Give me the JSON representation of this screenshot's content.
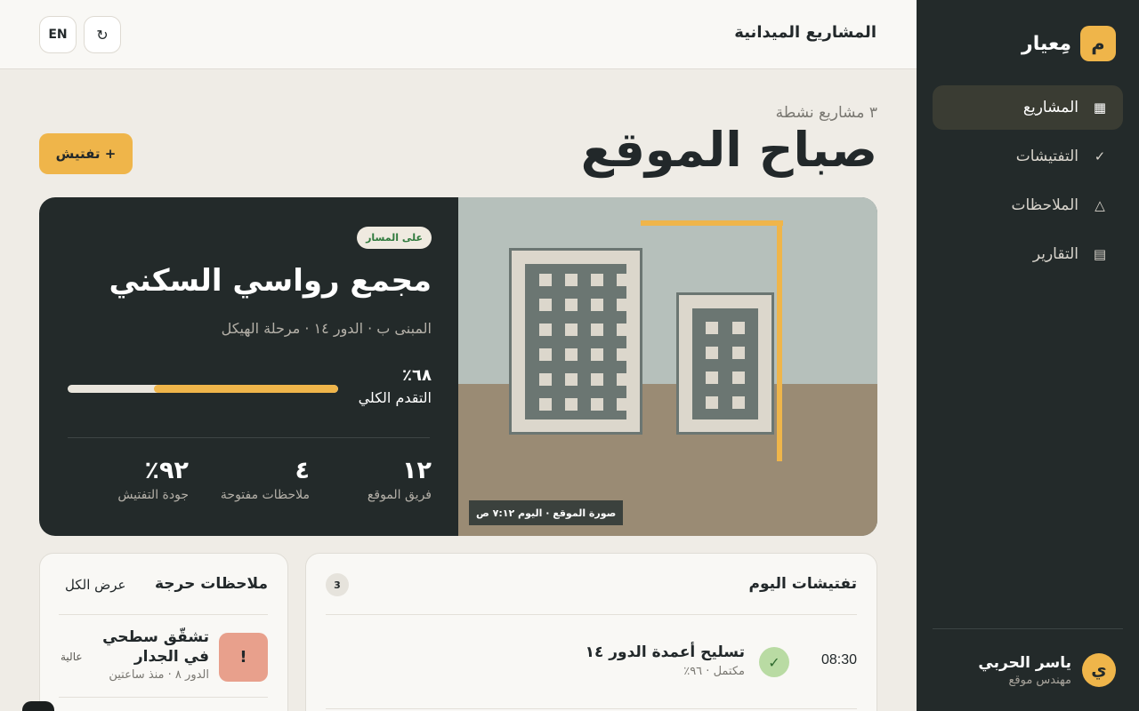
{
  "app": {
    "logo_letter": "م",
    "name": "مِعيار"
  },
  "sidebar": {
    "items": [
      {
        "label": "المشاريع",
        "icon": "grid-icon",
        "active": true
      },
      {
        "label": "التفتيشات",
        "icon": "check-icon",
        "active": false
      },
      {
        "label": "الملاحظات",
        "icon": "warning-triangle-icon",
        "active": false
      },
      {
        "label": "التقارير",
        "icon": "report-icon",
        "active": false
      }
    ],
    "icon_glyphs": [
      "▦",
      "✓",
      "△",
      "▤"
    ]
  },
  "user": {
    "initial": "ي",
    "name": "ياسر الحربي",
    "role": "مهندس موقع"
  },
  "topbar": {
    "title": "المشاريع الميدانية",
    "lang_label": "EN",
    "refresh_glyph": "↻"
  },
  "greeting": {
    "subtitle": "٣ مشاريع نشطة",
    "title": "صباح الموقع",
    "inspect_button": "+ تفتيش"
  },
  "project": {
    "status": "على المسار",
    "name": "مجمع رواسي السكني",
    "meta": "المبنى ب · الدور ١٤ · مرحلة الهيكل",
    "progress_pct_label": "٦٨٪",
    "progress_label": "التقدم الكلي",
    "progress_value": 0.68,
    "stats": [
      {
        "value": "١٢",
        "label": "فريق الموقع"
      },
      {
        "value": "٤",
        "label": "ملاحظات مفتوحة"
      },
      {
        "value": "٩٢٪",
        "label": "جودة التفتيش"
      }
    ],
    "photo_caption": "صورة الموقع · اليوم ٧:١٢ ص"
  },
  "inspections": {
    "title": "تفتيشات اليوم",
    "count": "3",
    "items": [
      {
        "time": "08:30",
        "name": "تسليح أعمدة الدور ١٤",
        "status": "مكتمل · ٩٦٪",
        "done_glyph": "✓"
      }
    ]
  },
  "notes": {
    "title": "ملاحظات حرجة",
    "view_all": "عرض الكل",
    "items": [
      {
        "alert_glyph": "!",
        "title": "تشقّق سطحي في الجدار",
        "meta": "الدور ٨ · منذ ساعتين",
        "severity": "عالية"
      }
    ]
  },
  "colors": {
    "accent": "#efb54a",
    "sidebar_bg": "#232a2a",
    "page_bg": "#efece6",
    "success": "#2f7a3d",
    "danger_soft": "#e8a08c"
  }
}
